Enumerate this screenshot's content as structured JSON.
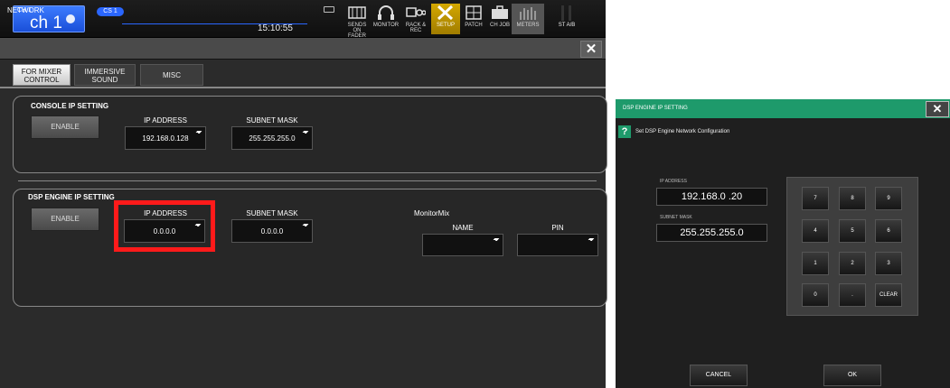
{
  "topbar": {
    "channel_small": "CH 1",
    "channel_name": "ch 1",
    "cs_tag": "CS 1",
    "clock": "15:10:55",
    "buttons": [
      {
        "label": "SENDS ON FADER"
      },
      {
        "label": "MONITOR"
      },
      {
        "label": "RACK & REC"
      },
      {
        "label": "SETUP"
      },
      {
        "label": "PATCH"
      },
      {
        "label": "CH JOB"
      },
      {
        "label": "METERS"
      },
      {
        "label": "ST A/B"
      }
    ]
  },
  "window": {
    "title": "NETWORK",
    "close_label": "✕",
    "tabs": [
      {
        "line1": "FOR MIXER",
        "line2": "CONTROL"
      },
      {
        "line1": "IMMERSIVE",
        "line2": "SOUND"
      },
      {
        "line1": "MISC",
        "line2": ""
      }
    ]
  },
  "console": {
    "title": "CONSOLE IP SETTING",
    "enable": "ENABLE",
    "ip_label": "IP ADDRESS",
    "ip_value": "192.168.0.128",
    "mask_label": "SUBNET MASK",
    "mask_value": "255.255.255.0"
  },
  "dsp_engine": {
    "title": "DSP ENGINE IP SETTING",
    "enable": "ENABLE",
    "ip_label": "IP ADDRESS",
    "ip_value": "0.0.0.0",
    "mask_label": "SUBNET MASK",
    "mask_value": "0.0.0.0",
    "monitormix_label": "MonitorMix",
    "name_label": "NAME",
    "pin_label": "PIN"
  },
  "dialog": {
    "title": "DSP ENGINE IP SETTING",
    "close_label": "✕",
    "message": "Set DSP Engine Network Configuration",
    "ip_label": "IP ADDRESS",
    "ip_value": "192.168.0 .20",
    "mask_label": "SUBNET MASK",
    "mask_value": "255.255.255.0",
    "keys": [
      "7",
      "8",
      "9",
      "4",
      "5",
      "6",
      "1",
      "2",
      "3",
      "0",
      ".",
      "CLEAR"
    ],
    "cancel": "CANCEL",
    "ok": "OK"
  },
  "colors": {
    "accent_blue": "#2a66ff",
    "setup_gold": "#d4a800",
    "dialog_green": "#1e9a6b",
    "highlight_red": "#ff1a1a"
  }
}
